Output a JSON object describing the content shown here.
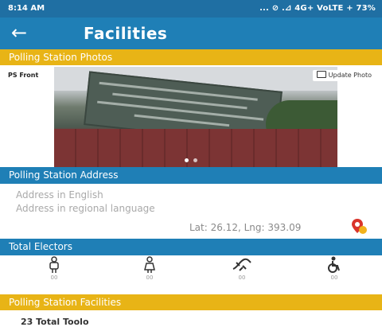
{
  "status_bar": {
    "time": "8:14 AM",
    "indicators": "... ⊘ .⊿ 4G+ VoLTE + 73%"
  },
  "app_bar": {
    "back_icon": "arrow-left-icon",
    "title": "Facilities"
  },
  "photos_section": {
    "header": "Polling Station Photos",
    "photo_caption": "PS Front",
    "update_photo_label": "Update Photo",
    "carousel_dots": 2
  },
  "address_section": {
    "header": "Polling Station Address",
    "address_english": "Address in English",
    "address_regional": "Address in regional language",
    "lat_lng": "Lat: 26.12, Lng: 393.09",
    "map_icon": "map-pin-icon"
  },
  "electors_section": {
    "header": "Total Electors",
    "items": [
      {
        "icon": "male-icon",
        "count": "00"
      },
      {
        "icon": "female-icon",
        "count": "00"
      },
      {
        "icon": "third-gender-icon",
        "count": "00"
      },
      {
        "icon": "wheelchair-icon",
        "count": "00"
      }
    ]
  },
  "facilities_section": {
    "header": "Polling Station Facilities",
    "first_item": "23 Total Toolo"
  },
  "colors": {
    "primary": "#1f7fb6",
    "accent": "#e8b416",
    "status_bar": "#1f6fa3"
  }
}
